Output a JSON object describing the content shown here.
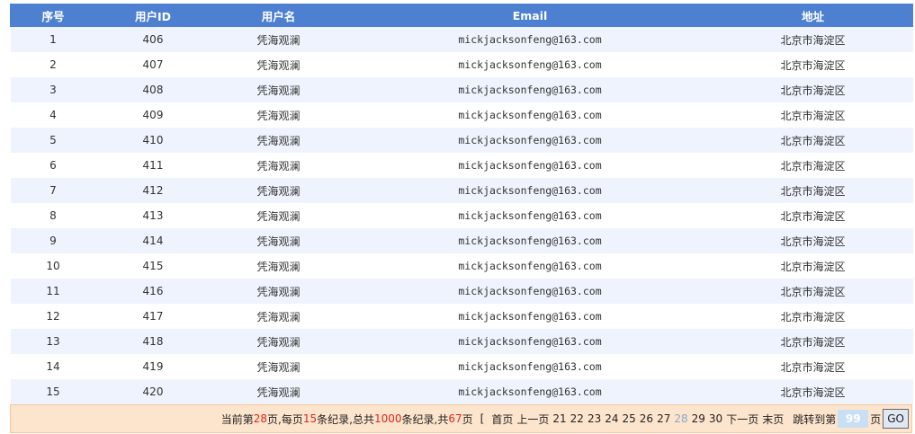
{
  "table": {
    "headers": [
      "序号",
      "用户ID",
      "用户名",
      "Email",
      "地址"
    ],
    "rows": [
      [
        "1",
        "406",
        "凭海观澜",
        "mickjacksonfeng@163.com",
        "北京市海淀区"
      ],
      [
        "2",
        "407",
        "凭海观澜",
        "mickjacksonfeng@163.com",
        "北京市海淀区"
      ],
      [
        "3",
        "408",
        "凭海观澜",
        "mickjacksonfeng@163.com",
        "北京市海淀区"
      ],
      [
        "4",
        "409",
        "凭海观澜",
        "mickjacksonfeng@163.com",
        "北京市海淀区"
      ],
      [
        "5",
        "410",
        "凭海观澜",
        "mickjacksonfeng@163.com",
        "北京市海淀区"
      ],
      [
        "6",
        "411",
        "凭海观澜",
        "mickjacksonfeng@163.com",
        "北京市海淀区"
      ],
      [
        "7",
        "412",
        "凭海观澜",
        "mickjacksonfeng@163.com",
        "北京市海淀区"
      ],
      [
        "8",
        "413",
        "凭海观澜",
        "mickjacksonfeng@163.com",
        "北京市海淀区"
      ],
      [
        "9",
        "414",
        "凭海观澜",
        "mickjacksonfeng@163.com",
        "北京市海淀区"
      ],
      [
        "10",
        "415",
        "凭海观澜",
        "mickjacksonfeng@163.com",
        "北京市海淀区"
      ],
      [
        "11",
        "416",
        "凭海观澜",
        "mickjacksonfeng@163.com",
        "北京市海淀区"
      ],
      [
        "12",
        "417",
        "凭海观澜",
        "mickjacksonfeng@163.com",
        "北京市海淀区"
      ],
      [
        "13",
        "418",
        "凭海观澜",
        "mickjacksonfeng@163.com",
        "北京市海淀区"
      ],
      [
        "14",
        "419",
        "凭海观澜",
        "mickjacksonfeng@163.com",
        "北京市海淀区"
      ],
      [
        "15",
        "420",
        "凭海观澜",
        "mickjacksonfeng@163.com",
        "北京市海淀区"
      ]
    ]
  },
  "pager": {
    "prefix": "当前第",
    "current_page": "28",
    "page_suffix": "页,每页",
    "per_page": "15",
    "per_page_suffix": "条纪录,总共",
    "total_records": "1000",
    "total_suffix": "条纪录,共",
    "total_pages": "67",
    "total_pages_suffix": "页",
    "bracket": "[",
    "first_label": "首页",
    "prev_label": "上一页",
    "pages": [
      "21",
      "22",
      "23",
      "24",
      "25",
      "26",
      "27",
      "28",
      "29",
      "30"
    ],
    "next_label": "下一页",
    "last_label": "末页",
    "jump_label": "跳转到第",
    "jump_value": "99",
    "jump_suffix": "页",
    "go_label": "GO"
  },
  "colors": {
    "header_bg": "#4e80d1",
    "row_alt_bg": "#eef3fd",
    "pager_bg": "#fde5cd",
    "highlight": "#e0241c",
    "current_page": "#8aa6c8"
  }
}
